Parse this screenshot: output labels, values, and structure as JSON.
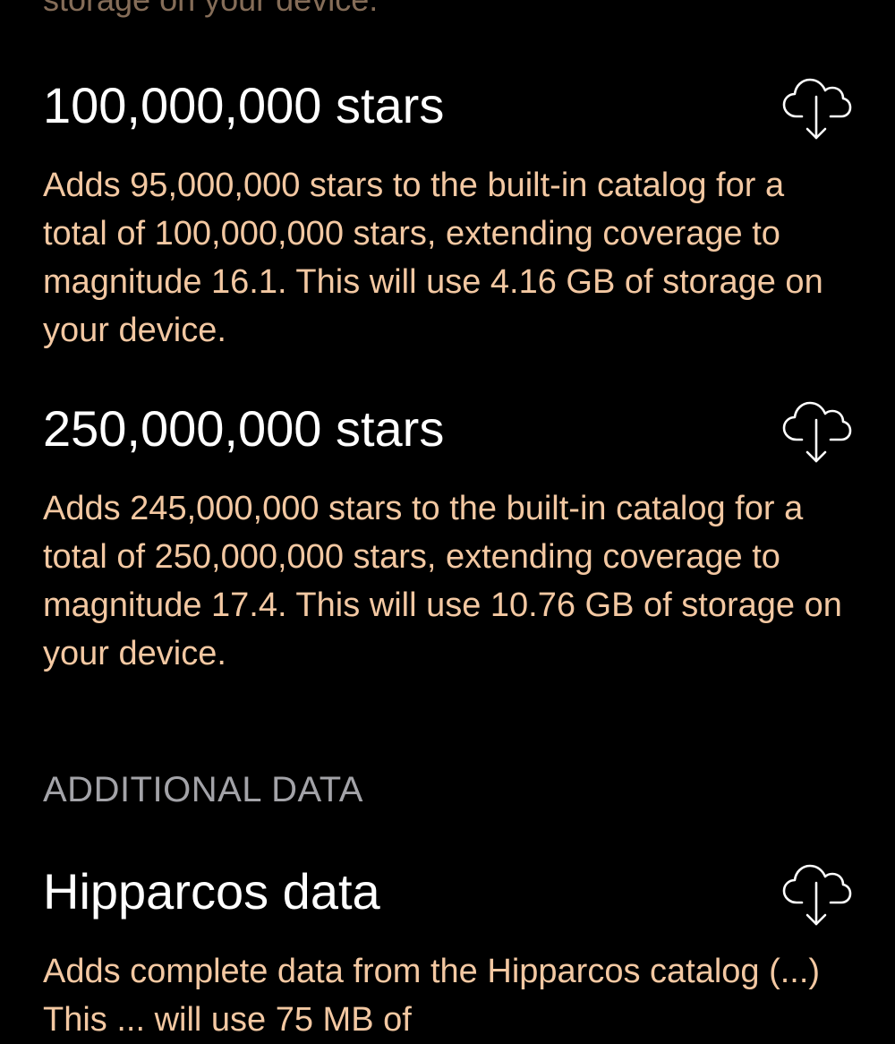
{
  "top_fragment": "storage on your device.",
  "catalog_items": [
    {
      "title": "100,000,000 stars",
      "description": "Adds 95,000,000 stars to the built-in catalog for a total of 100,000,000 stars, extending coverage to magnitude 16.1. This will use 4.16 GB of storage on your device.",
      "icon": "cloud-download-icon"
    },
    {
      "title": "250,000,000 stars",
      "description": "Adds 245,000,000 stars to the built-in catalog for a total of 250,000,000 stars, extending coverage to magnitude 17.4. This will use 10.76 GB of storage on your device.",
      "icon": "cloud-download-icon"
    }
  ],
  "additional_section": {
    "header": "ADDITIONAL DATA",
    "items": [
      {
        "title": "Hipparcos data",
        "description": "Adds complete data from the Hipparcos catalog (...) This ... will use 75 MB of",
        "icon": "cloud-download-icon"
      }
    ]
  },
  "colors": {
    "background": "#000000",
    "title": "#ffffff",
    "description": "#f3c8a2",
    "section_header": "#a3a3a8",
    "icon_stroke": "#ffffff"
  }
}
